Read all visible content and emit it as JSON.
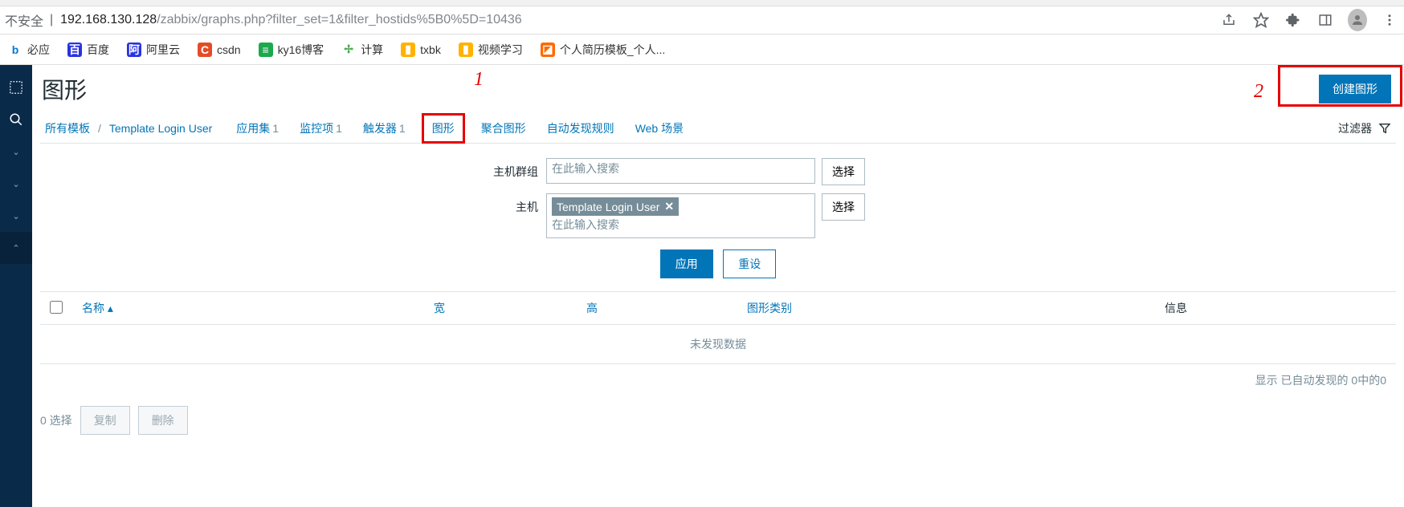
{
  "browser": {
    "insecure_label": "不安全",
    "url_host": "192.168.130.128",
    "url_path": "/zabbix/graphs.php?filter_set=1&filter_hostids%5B0%5D=10436"
  },
  "bookmarks": [
    {
      "label": "必应",
      "icon": "b",
      "bg": "#fff",
      "fg": "#0078d4"
    },
    {
      "label": "百度",
      "icon": "百",
      "bg": "#2932e1",
      "fg": "#fff"
    },
    {
      "label": "阿里云",
      "icon": "阿",
      "bg": "#2932e1",
      "fg": "#fff"
    },
    {
      "label": "csdn",
      "icon": "C",
      "bg": "#e34c26",
      "fg": "#fff"
    },
    {
      "label": "ky16博客",
      "icon": "≡",
      "bg": "#1ba94c",
      "fg": "#fff"
    },
    {
      "label": "计算",
      "icon": "✢",
      "bg": "#fff",
      "fg": "#4caf50"
    },
    {
      "label": "txbk",
      "icon": "▮",
      "bg": "#ffb300",
      "fg": "#fff"
    },
    {
      "label": "视频学习",
      "icon": "▮",
      "bg": "#ffb300",
      "fg": "#fff"
    },
    {
      "label": "个人简历模板_个人...",
      "icon": "◪",
      "bg": "#ff6a00",
      "fg": "#fff"
    }
  ],
  "page": {
    "title": "图形",
    "create_btn": "创建图形",
    "anno1": "1",
    "anno2": "2"
  },
  "tabs": {
    "all_templates": "所有模板",
    "template_name": "Template Login User",
    "apps": "应用集",
    "apps_n": "1",
    "items": "监控项",
    "items_n": "1",
    "triggers": "触发器",
    "triggers_n": "1",
    "graphs": "图形",
    "screens": "聚合图形",
    "discovery": "自动发现规则",
    "web": "Web 场景",
    "filter_label": "过滤器"
  },
  "filter": {
    "hostgroup_label": "主机群组",
    "host_label": "主机",
    "search_ph": "在此输入搜索",
    "select_btn": "选择",
    "host_tag": "Template Login User",
    "apply": "应用",
    "reset": "重设"
  },
  "table": {
    "cols": {
      "name": "名称",
      "width": "宽",
      "height": "高",
      "type": "图形类别",
      "info": "信息"
    },
    "sort_indicator": "▴",
    "empty": "未发现数据",
    "summary": "显示 已自动发现的 0中的0"
  },
  "footer": {
    "selected": "0 选择",
    "copy": "复制",
    "delete": "删除"
  }
}
